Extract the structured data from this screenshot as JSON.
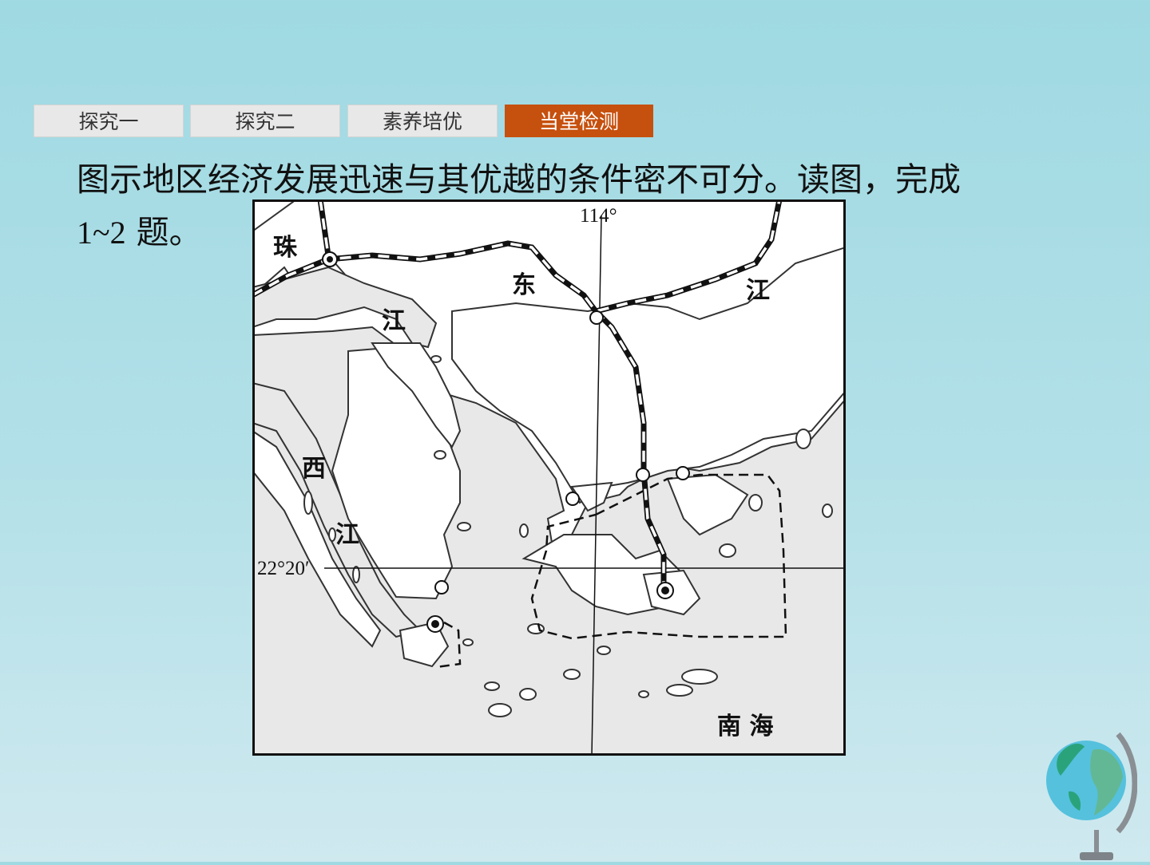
{
  "tabs": [
    {
      "label": "探究一",
      "active": false
    },
    {
      "label": "探究二",
      "active": false
    },
    {
      "label": "素养培优",
      "active": false
    },
    {
      "label": "当堂检测",
      "active": true
    }
  ],
  "question": {
    "line1": "图示地区经济发展迅速与其优越的条件密不可分。读图，完成",
    "line2_num": "1~2",
    "line2_text": " 题。"
  },
  "map": {
    "longitude_label": "114°",
    "latitude_label": "22°20′",
    "labels": {
      "zhu": "珠",
      "dong": "东",
      "jiang_east": "江",
      "jiang_pearl": "江",
      "xi": "西",
      "jiang_west": "江",
      "nanhai": "南  海"
    }
  },
  "colors": {
    "active_tab": "#c6500e",
    "sea": "#e8e8e8"
  }
}
